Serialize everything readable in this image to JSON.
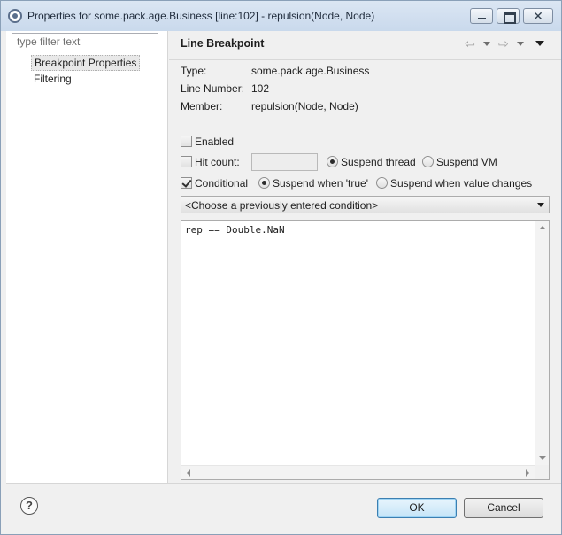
{
  "window": {
    "title": "Properties for some.pack.age.Business [line:102] - repulsion(Node, Node)",
    "close_glyph": "✕"
  },
  "sidebar": {
    "filter_placeholder": "type filter text",
    "filter_value": "",
    "items": [
      {
        "label": "Breakpoint Properties",
        "selected": true
      },
      {
        "label": "Filtering",
        "selected": false
      }
    ]
  },
  "page": {
    "title": "Line Breakpoint",
    "nav_back_glyph": "⇦",
    "nav_forward_glyph": "⇨"
  },
  "info": {
    "type_label": "Type:",
    "type_value": "some.pack.age.Business",
    "line_label": "Line Number:",
    "line_value": "102",
    "member_label": "Member:",
    "member_value": "repulsion(Node, Node)"
  },
  "options": {
    "enabled_label": "Enabled",
    "enabled_checked": false,
    "hitcount_label": "Hit count:",
    "hitcount_checked": false,
    "hitcount_value": "",
    "suspend_thread_label": "Suspend thread",
    "suspend_vm_label": "Suspend VM",
    "suspend_policy": "thread",
    "conditional_label": "Conditional",
    "conditional_checked": true,
    "suspend_true_label": "Suspend when 'true'",
    "suspend_changes_label": "Suspend when value changes",
    "condition_mode": "true"
  },
  "condition": {
    "combo_text": "<Choose a previously entered condition>",
    "expression": "rep == Double.NaN"
  },
  "footer": {
    "help_glyph": "?",
    "ok_label": "OK",
    "cancel_label": "Cancel"
  },
  "colors": {
    "ok_button_border": "#3c7fb1",
    "titlebar": "#c9d9ec"
  }
}
